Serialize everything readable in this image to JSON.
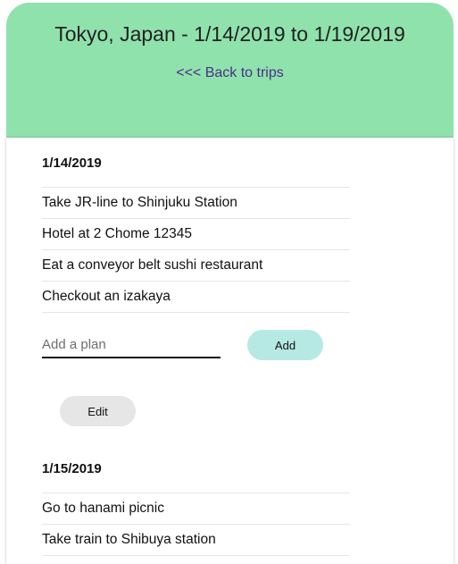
{
  "header": {
    "title": "Tokyo, Japan - 1/14/2019 to 1/19/2019",
    "back_link": "<<< Back to trips"
  },
  "days": [
    {
      "date": "1/14/2019",
      "plans": [
        "Take JR-line to Shinjuku Station",
        "Hotel at 2 Chome 12345",
        "Eat a conveyor belt sushi restaurant",
        "Checkout an izakaya"
      ],
      "add_plan_placeholder": "Add a plan",
      "add_label": "Add",
      "edit_label": "Edit"
    },
    {
      "date": "1/15/2019",
      "plans": [
        "Go to hanami picnic",
        "Take train to Shibuya station"
      ]
    }
  ],
  "colors": {
    "header_bg": "#90e2ac",
    "link": "#4a2f86",
    "add_button_bg": "#b6e9e4",
    "edit_button_bg": "#e6e6e6"
  }
}
